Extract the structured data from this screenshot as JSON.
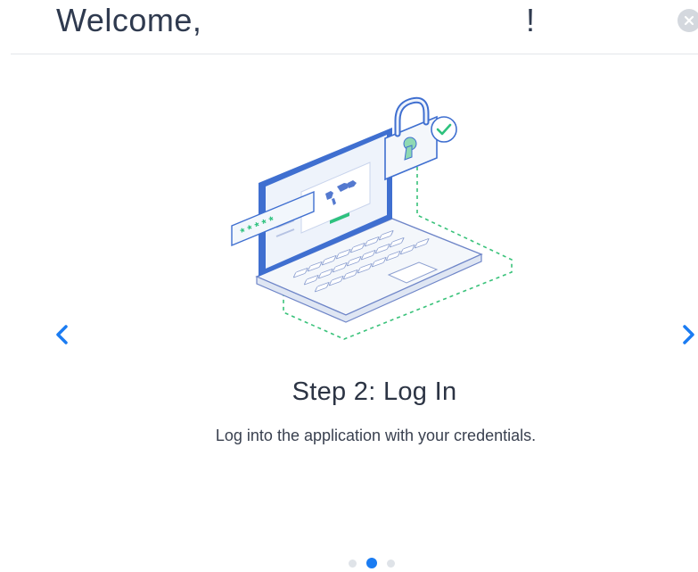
{
  "header": {
    "welcome_text": "Welcome,",
    "exclamation": "!",
    "close_icon": "close-icon"
  },
  "illustration": {
    "icon": "laptop-login-illustration",
    "password_mask": "* * * * *"
  },
  "navigation": {
    "prev_icon": "chevron-left-icon",
    "next_icon": "chevron-right-icon"
  },
  "step": {
    "title": "Step 2: Log In",
    "description": "Log into the application with your credentials."
  },
  "pagination": {
    "total": 3,
    "current": 2
  },
  "colors": {
    "accent": "#1b7cf2",
    "title_text": "#2f3a4f",
    "success_green": "#2ec27e",
    "outline_blue": "#3f6fd0"
  }
}
